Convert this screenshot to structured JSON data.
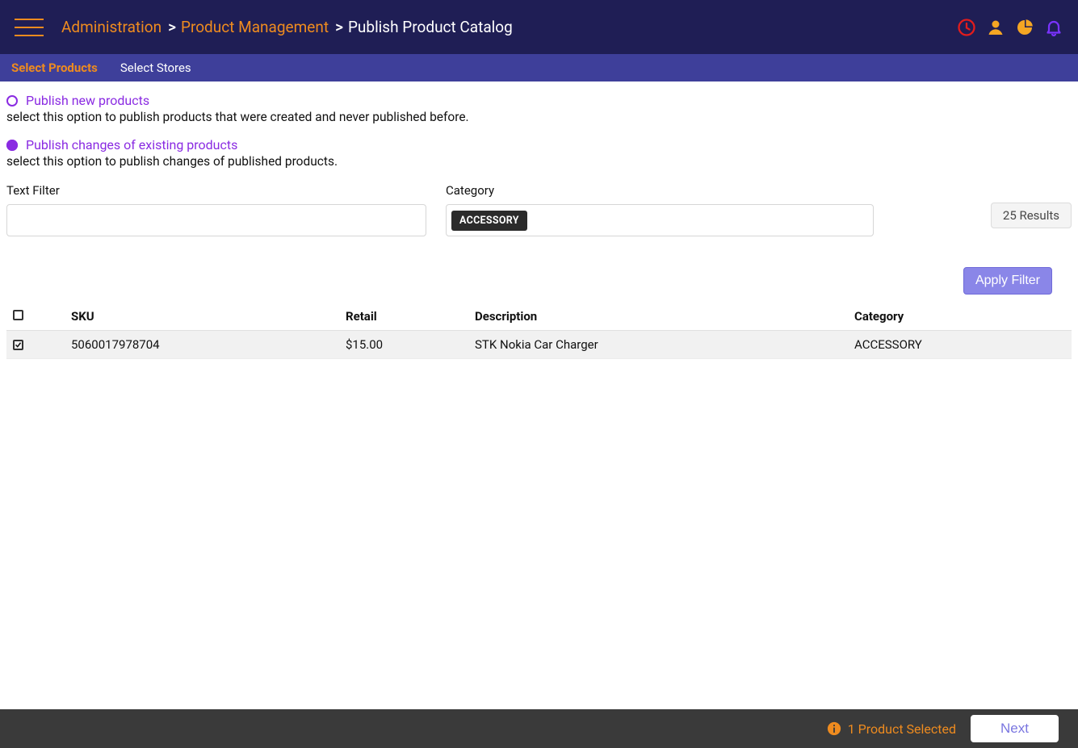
{
  "header": {
    "breadcrumb": {
      "level1": "Administration",
      "level2": "Product Management",
      "current": "Publish Product Catalog"
    }
  },
  "tabs": {
    "select_products": "Select Products",
    "select_stores": "Select Stores"
  },
  "options": {
    "new": {
      "label": "Publish new products",
      "desc": "select this option to publish products that were created and never published before."
    },
    "existing": {
      "label": "Publish changes of existing products",
      "desc": "select this option to publish changes of published products."
    }
  },
  "filters": {
    "text_label": "Text Filter",
    "text_value": "",
    "category_label": "Category",
    "category_chip": "ACCESSORY",
    "results_badge": "25 Results",
    "apply_label": "Apply Filter"
  },
  "table": {
    "cols": {
      "sku": "SKU",
      "retail": "Retail",
      "description": "Description",
      "category": "Category"
    },
    "row0": {
      "checked": true,
      "sku": "5060017978704",
      "retail": "$15.00",
      "description": "STK Nokia Car Charger",
      "category": "ACCESSORY"
    }
  },
  "footer": {
    "selected_text": "1 Product Selected",
    "next_label": "Next"
  }
}
